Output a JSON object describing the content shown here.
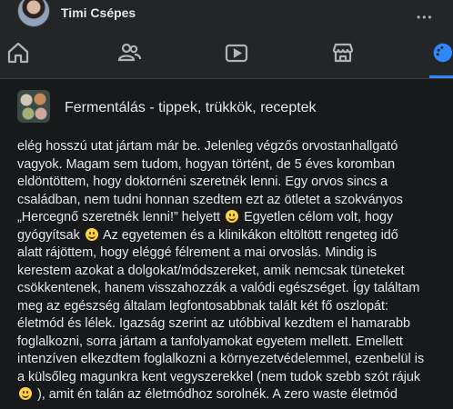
{
  "profile": {
    "name": "Timi Csépes"
  },
  "nav": {
    "items": [
      {
        "icon": "home-icon"
      },
      {
        "icon": "groups-icon"
      },
      {
        "icon": "watch-icon"
      },
      {
        "icon": "marketplace-icon"
      },
      {
        "icon": "gaming-icon",
        "active": true
      }
    ],
    "accent": "#2d88ff"
  },
  "group": {
    "title": "Fermentálás - tippek, trükkök, receptek"
  },
  "post": {
    "lines": [
      {
        "text": "elég hosszú utat jártam már be. Jelenleg végzős orvostanhallgató"
      },
      {
        "text": "vagyok. Magam sem tudom, hogyan történt, de 5 éves koromban"
      },
      {
        "text": "eldöntöttem, hogy doktornéni szeretnék lenni. Egy orvos sincs a"
      },
      {
        "text": "családban, nem tudni honnan szedtem ezt az ötletet a szokványos"
      },
      {
        "text": "„Hercegnő szeretnék lenni!” helyett",
        "emoji": true,
        "after": "Egyetlen célom volt, hogy"
      },
      {
        "text": "gyógyítsak",
        "emoji": true,
        "after": "Az egyetemen és a klinikákon eltöltött rengeteg idő"
      },
      {
        "text": "alatt rájöttem, hogy eléggé félrement a mai orvoslás. Mindig is"
      },
      {
        "text": "kerestem azokat a dolgokat/módszereket, amik nemcsak tüneteket"
      },
      {
        "text": "csökkentenek, hanem visszahozzák a valódi egészséget. Így találtam"
      },
      {
        "text": "meg az egészség általam legfontosabbnak talált két fő oszlopát:"
      },
      {
        "text": "életmód és lélek. Igazság szerint az utóbbival kezdtem el hamarabb"
      },
      {
        "text": "foglalkozni, sorra jártam a tanfolyamokat egyetem mellett. Emellett"
      },
      {
        "text": "intenzíven elkezdtem foglalkozni a környezetvédelemmel, ezenbelül is"
      },
      {
        "text": "a külsőleg magunkra kent vegyszerekkel (nem tudok szebb szót rájuk"
      },
      {
        "text": "",
        "emoji": true,
        "after": "), amit én talán az életmódhoz sorolnék. A zero waste életmód"
      }
    ]
  }
}
